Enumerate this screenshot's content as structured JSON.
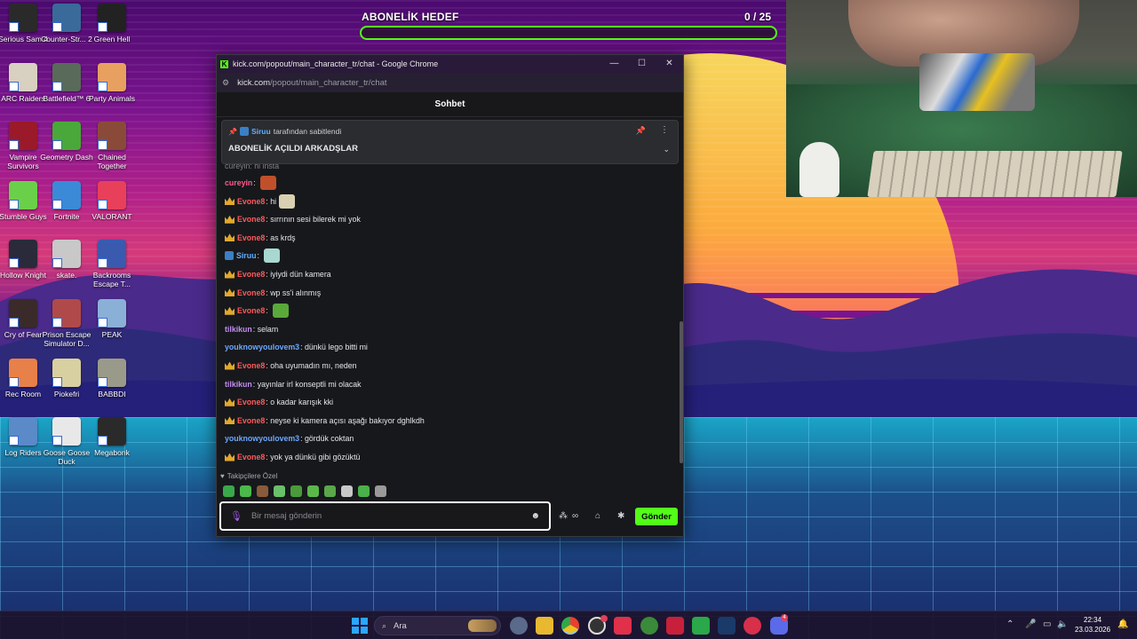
{
  "desktop": {
    "icons": [
      {
        "label": "Serious Sam 4",
        "color": "#2a2a2a"
      },
      {
        "label": "Counter-Str... 2",
        "color": "#3a6a9a"
      },
      {
        "label": "Green Hell",
        "color": "#222222"
      },
      {
        "label": "ARC Raiders",
        "color": "#d8d0c0"
      },
      {
        "label": "Battlefield™ 6",
        "color": "#5a6a5a"
      },
      {
        "label": "Party Animals",
        "color": "#e8a060"
      },
      {
        "label": "Vampire Survivors",
        "color": "#9a1a2a"
      },
      {
        "label": "Geometry Dash",
        "color": "#4aa83a"
      },
      {
        "label": "Chained Together",
        "color": "#8a4a3a"
      },
      {
        "label": "Stumble Guys",
        "color": "#6ad04a"
      },
      {
        "label": "Fortnite",
        "color": "#3a8ad8"
      },
      {
        "label": "VALORANT",
        "color": "#e8405a"
      },
      {
        "label": "Hollow Knight",
        "color": "#2a2a3a"
      },
      {
        "label": "skate.",
        "color": "#c8c8c8"
      },
      {
        "label": "Backrooms Escape T...",
        "color": "#3a5ab0"
      },
      {
        "label": "Cry of Fear",
        "color": "#3a2a2a"
      },
      {
        "label": "Prison Escape Simulator D...",
        "color": "#b04a4a"
      },
      {
        "label": "PEAK",
        "color": "#8ab0d8"
      },
      {
        "label": "Rec Room",
        "color": "#e8804a"
      },
      {
        "label": "Piokefri",
        "color": "#d8d0a0"
      },
      {
        "label": "BABBDI",
        "color": "#9a9a8a"
      },
      {
        "label": "Log Riders",
        "color": "#5a8ac8"
      },
      {
        "label": "Goose Goose Duck",
        "color": "#e8e8e8"
      },
      {
        "label": "Megabonk",
        "color": "#2a2a2a"
      }
    ]
  },
  "goal": {
    "title": "ABONELİK HEDEF",
    "count": "0  / 25",
    "progress": 0
  },
  "window": {
    "title": "kick.com/popout/main_character_tr/chat - Google Chrome",
    "minimize": "—",
    "maximize": "☐",
    "close": "✕",
    "url_host": "kick.com",
    "url_path": "/popout/main_character_tr/chat"
  },
  "chat": {
    "header": "Sohbet",
    "pinned": {
      "user": "Siruu",
      "suffix": "tarafından sabitlendi",
      "message": "ABONELİK AÇILDI ARKADŞLAR"
    },
    "partial_top": "cureyin: hi insta",
    "messages": [
      {
        "user": "cureyin",
        "color": "#ff5a8a",
        "badge": "none",
        "text": "",
        "emote": "#c0502a"
      },
      {
        "user": "Evone8",
        "color": "#ff5a5a",
        "badge": "crown",
        "text": "hi",
        "emote": "#d8d0b0"
      },
      {
        "user": "Evone8",
        "color": "#ff5a5a",
        "badge": "crown",
        "text": "sırrının sesi bilerek mi yok",
        "emote": ""
      },
      {
        "user": "Evone8",
        "color": "#ff5a5a",
        "badge": "crown",
        "text": "as krdş",
        "emote": ""
      },
      {
        "user": "Siruu",
        "color": "#62b0ff",
        "badge": "blue",
        "text": "",
        "emote": "#a8d8d0"
      },
      {
        "user": "Evone8",
        "color": "#ff5a5a",
        "badge": "crown",
        "text": "iyiydi dün kamera",
        "emote": ""
      },
      {
        "user": "Evone8",
        "color": "#ff5a5a",
        "badge": "crown",
        "text": "wp ss'i alınmış",
        "emote": ""
      },
      {
        "user": "Evone8",
        "color": "#ff5a5a",
        "badge": "crown",
        "text": "",
        "emote": "#5aa83a"
      },
      {
        "user": "tilkikun",
        "color": "#c28ef0",
        "badge": "none",
        "text": "selam",
        "emote": ""
      },
      {
        "user": "youknowyoulovem3",
        "color": "#6aa8ff",
        "badge": "none",
        "text": "dünkü lego bitti mi",
        "emote": ""
      },
      {
        "user": "Evone8",
        "color": "#ff5a5a",
        "badge": "crown",
        "text": "oha uyumadın mı, neden",
        "emote": ""
      },
      {
        "user": "tilkikun",
        "color": "#c28ef0",
        "badge": "none",
        "text": "yayınlar irl konseptli mi olacak",
        "emote": ""
      },
      {
        "user": "Evone8",
        "color": "#ff5a5a",
        "badge": "crown",
        "text": "o kadar karışık kki",
        "emote": ""
      },
      {
        "user": "Evone8",
        "color": "#ff5a5a",
        "badge": "crown",
        "text": "neyse ki kamera açısı aşağı bakıyor dghlkdh",
        "emote": ""
      },
      {
        "user": "youknowyoulovem3",
        "color": "#6aa8ff",
        "badge": "none",
        "text": "gördük coktan",
        "emote": ""
      },
      {
        "user": "Evone8",
        "color": "#ff5a5a",
        "badge": "crown",
        "text": "yok ya dünkü gibi gözüktü",
        "emote": ""
      }
    ],
    "followers_label": "Takipçilere Özel",
    "emotes": [
      "#3aa84a",
      "#4ab84a",
      "#8a5a3a",
      "#6ac06a",
      "#4a9a3a",
      "#5ab84a",
      "#5aa84a",
      "#c8c8c8",
      "#4ab04a",
      "#9a9a9a"
    ],
    "input_placeholder": "Bir mesaj gönderin",
    "send_label": "Gönder"
  },
  "taskbar": {
    "search_label": "Ara",
    "time": "22:34",
    "date": "23.03.2026",
    "discord_badge": "4"
  }
}
